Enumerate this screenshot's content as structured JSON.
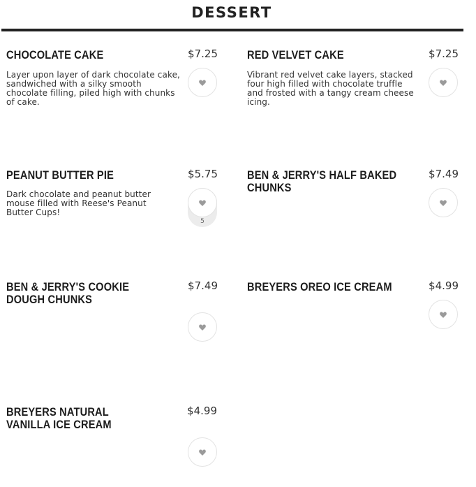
{
  "section": {
    "title": "DESSERT"
  },
  "items": [
    {
      "name": "CHOCOLATE CAKE",
      "price": "$7.25",
      "description": "Layer upon layer of dark chocolate cake, sandwiched with a silky smooth chocolate filling, piled high with chunks of cake.",
      "favorite_count": ""
    },
    {
      "name": "RED VELVET CAKE",
      "price": "$7.25",
      "description": "Vibrant red velvet cake layers, stacked four high filled with chocolate truffle and frosted with a tangy cream cheese icing.",
      "favorite_count": ""
    },
    {
      "name": "PEANUT BUTTER PIE",
      "price": "$5.75",
      "description": "Dark chocolate and peanut butter mouse filled with Reese's Peanut Butter Cups!",
      "favorite_count": "5"
    },
    {
      "name": "BEN & JERRY'S HALF BAKED CHUNKS",
      "price": "$7.49",
      "description": "",
      "favorite_count": ""
    },
    {
      "name": "BEN & JERRY'S COOKIE DOUGH CHUNKS",
      "price": "$7.49",
      "description": "",
      "favorite_count": ""
    },
    {
      "name": "BREYERS OREO ICE CREAM",
      "price": "$4.99",
      "description": "",
      "favorite_count": ""
    },
    {
      "name": "BREYERS NATURAL VANILLA ICE CREAM",
      "price": "$4.99",
      "description": "",
      "favorite_count": ""
    }
  ],
  "colors": {
    "text": "#222222",
    "rule": "#222222",
    "heart": "#9a9a9a",
    "button_border": "#e3e3e3"
  },
  "icons": {
    "favorite": "heart-icon"
  }
}
